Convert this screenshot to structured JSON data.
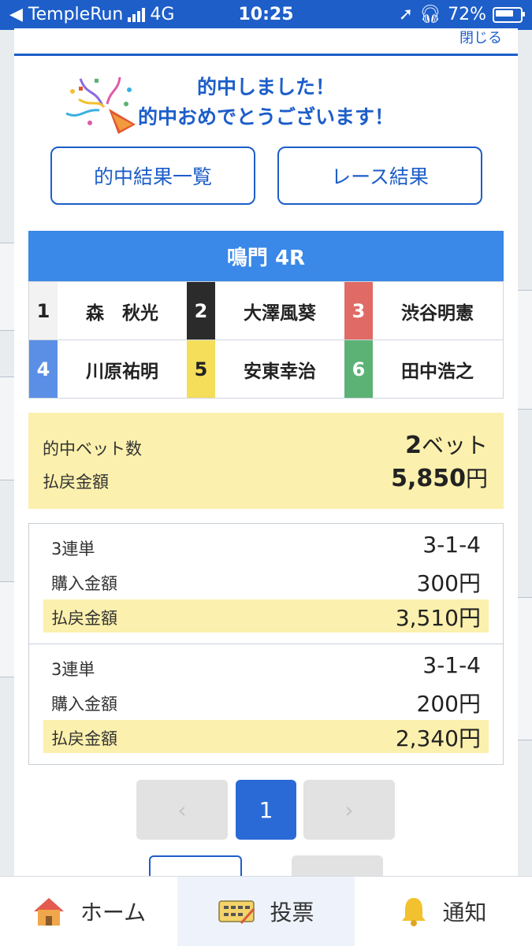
{
  "status_bar": {
    "carrier": "◀ TempleRun",
    "network": "4G",
    "time": "10:25",
    "battery": "72%"
  },
  "modal": {
    "close_label": "閉じる",
    "message_line1": "的中しました！",
    "message_line2": "的中おめでとうございます！",
    "buttons": {
      "hit_results": "的中結果一覧",
      "race_results": "レース結果"
    },
    "race_title": "鳴門 4R",
    "racers": [
      {
        "num": "1",
        "name": "森　秋光",
        "bg": "#f2f2f2",
        "fg": "#222222"
      },
      {
        "num": "2",
        "name": "大澤風葵",
        "bg": "#2b2b2b",
        "fg": "#ffffff"
      },
      {
        "num": "3",
        "name": "渋谷明憲",
        "bg": "#e06b66",
        "fg": "#ffffff"
      },
      {
        "num": "4",
        "name": "川原祐明",
        "bg": "#5b8fe6",
        "fg": "#ffffff"
      },
      {
        "num": "5",
        "name": "安東幸治",
        "bg": "#f4de5a",
        "fg": "#222222"
      },
      {
        "num": "6",
        "name": "田中浩之",
        "bg": "#5bb274",
        "fg": "#ffffff"
      }
    ],
    "summary": {
      "hit_count_label": "的中ベット数",
      "hit_count_value": "2",
      "hit_count_unit": "ベット",
      "payout_label": "払戻金額",
      "payout_value": "5,850",
      "payout_unit": "円"
    },
    "bets": [
      {
        "type": "3連単",
        "combo": "3-1-4",
        "purchase_label": "購入金額",
        "purchase": "300円",
        "payout_label": "払戻金額",
        "payout": "3,510円"
      },
      {
        "type": "3連単",
        "combo": "3-1-4",
        "purchase_label": "購入金額",
        "purchase": "200円",
        "payout_label": "払戻金額",
        "payout": "2,340円"
      }
    ],
    "pager": {
      "prev": "‹",
      "current": "1",
      "next": "›"
    }
  },
  "bottom_nav": {
    "home": "ホーム",
    "vote": "投票",
    "notify": "通知"
  },
  "colors": {
    "primary": "#1d5ec9",
    "race_header": "#3a88e8",
    "highlight": "#fbf0ad"
  }
}
